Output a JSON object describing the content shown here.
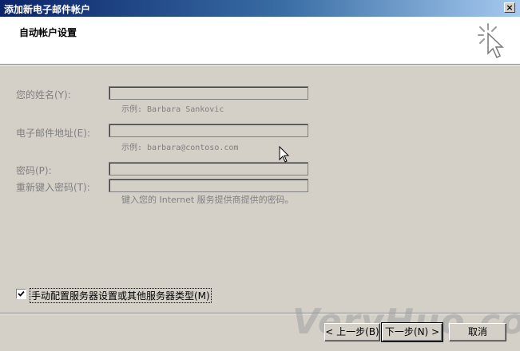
{
  "window": {
    "title": "添加新电子邮件帐户",
    "close_glyph": "×"
  },
  "header": {
    "title": "自动帐户设置"
  },
  "form": {
    "name_label": "您的姓名(Y):",
    "name_hint": "示例: Barbara Sankovic",
    "name_value": "",
    "email_label": "电子邮件地址(E):",
    "email_hint": "示例: barbara@contoso.com",
    "email_value": "",
    "password_label": "密码(P):",
    "password_value": "",
    "retype_label": "重新键入密码(T):",
    "retype_value": "",
    "password_hint": "键入您的 Internet 服务提供商提供的密码。"
  },
  "manual_config": {
    "label": "手动配置服务器设置或其他服务器类型(M)",
    "checked": true
  },
  "buttons": {
    "back": "< 上一步(B)",
    "next": "下一步(N) >",
    "cancel": "取消"
  },
  "watermark": "VeryHuo.com",
  "colors": {
    "title_start": "#0a246a",
    "title_end": "#a6caf0",
    "disabled_text": "#808080",
    "dialog_bg": "#d4d0c8"
  }
}
